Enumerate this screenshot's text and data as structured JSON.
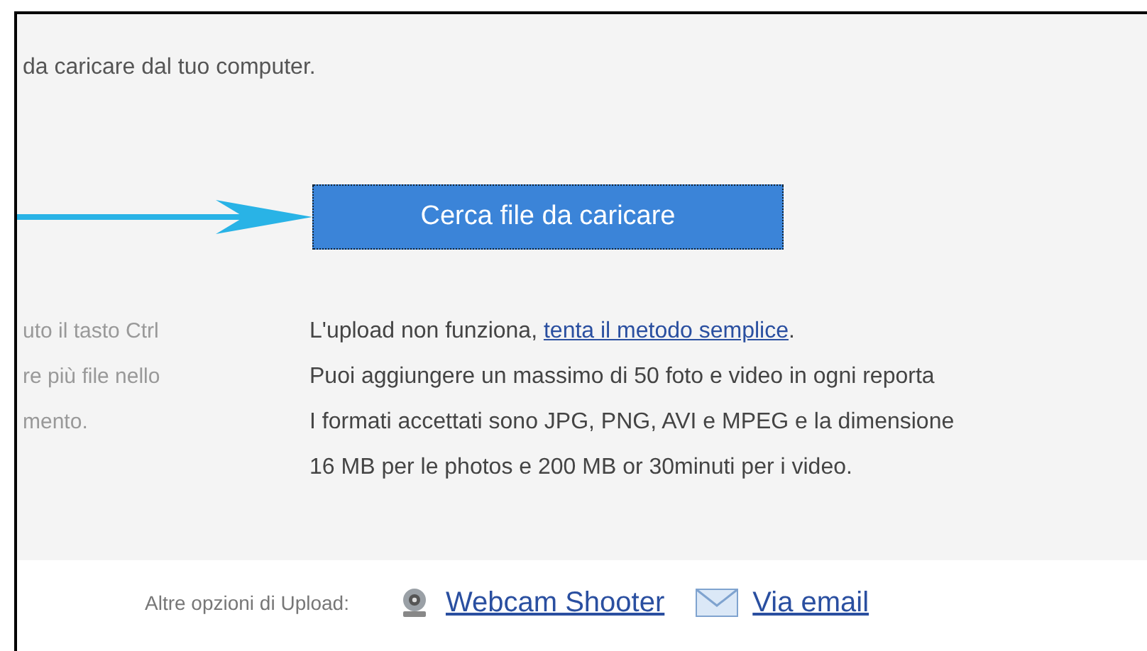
{
  "intro": "da caricare dal tuo computer.",
  "browse_button": "Cerca file da caricare",
  "side_note": [
    "uto il tasto Ctrl",
    "re più file nello",
    "mento."
  ],
  "info": {
    "prefix": "L'upload non funziona, ",
    "link": "tenta il metodo semplice",
    "suffix": ".",
    "lines": [
      "Puoi aggiungere un massimo di 50 foto e video in ogni reporta",
      "I formati accettati sono JPG, PNG, AVI e MPEG e la dimensione",
      "16 MB per le photos e 200 MB or 30minuti per i video."
    ]
  },
  "footer": {
    "label": "Altre opzioni di Upload:",
    "options": [
      {
        "kind": "webcam",
        "label": "Webcam Shooter"
      },
      {
        "kind": "email",
        "label": "Via email"
      }
    ]
  }
}
